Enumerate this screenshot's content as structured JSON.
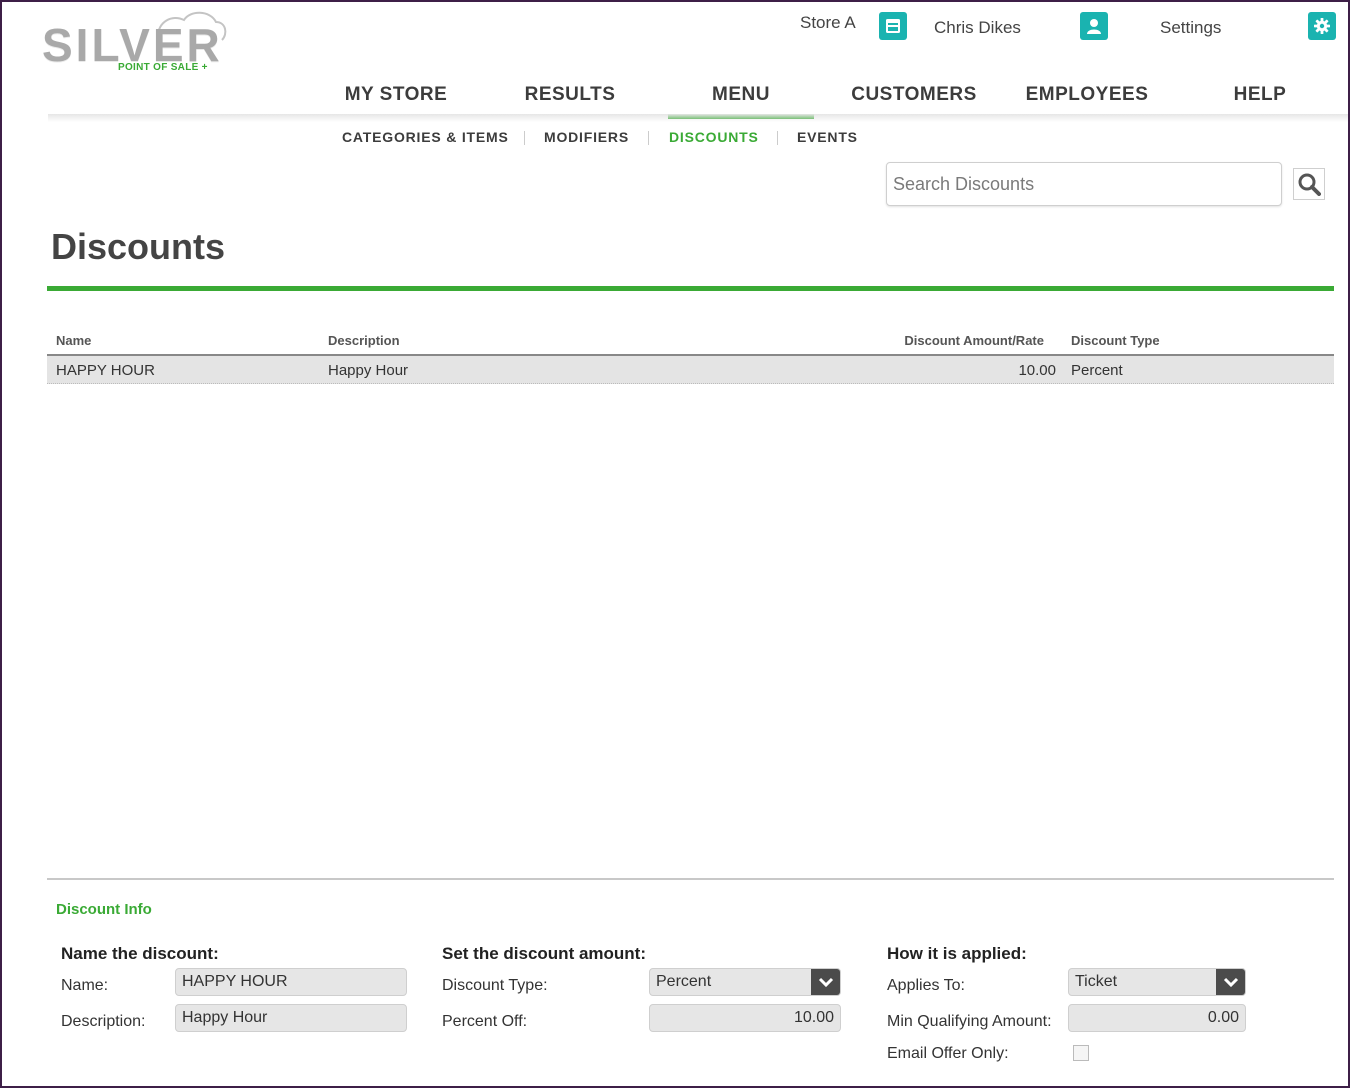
{
  "brand": {
    "logo_text": "SILVER",
    "logo_sub": "POINT OF SALE +",
    "accent_color": "#3aaa35",
    "icon_color": "#1ab3b0"
  },
  "utility": {
    "store": "Store A",
    "store_icon": "store-icon",
    "user": "Chris Dikes",
    "user_icon": "user-icon",
    "settings": "Settings",
    "settings_icon": "gear-icon"
  },
  "main_nav": {
    "items": [
      "MY STORE",
      "RESULTS",
      "MENU",
      "CUSTOMERS",
      "EMPLOYEES",
      "HELP"
    ],
    "active": "MENU"
  },
  "sub_nav": {
    "items": [
      "CATEGORIES & ITEMS",
      "MODIFIERS",
      "DISCOUNTS",
      "EVENTS"
    ],
    "active": "DISCOUNTS"
  },
  "search": {
    "placeholder": "Search Discounts",
    "icon": "search-icon"
  },
  "page": {
    "title": "Discounts"
  },
  "table": {
    "headers": {
      "name": "Name",
      "description": "Description",
      "amount": "Discount Amount/Rate",
      "type": "Discount Type"
    },
    "rows": [
      {
        "name": "HAPPY HOUR",
        "description": "Happy Hour",
        "amount": "10.00",
        "type": "Percent"
      }
    ]
  },
  "discount_info": {
    "title": "Discount Info",
    "name_group": {
      "heading": "Name the discount:",
      "name_label": "Name:",
      "name_value": "HAPPY HOUR",
      "description_label": "Description:",
      "description_value": "Happy Hour"
    },
    "amount_group": {
      "heading": "Set the discount amount:",
      "type_label": "Discount Type:",
      "type_value": "Percent",
      "percent_label": "Percent Off:",
      "percent_value": "10.00"
    },
    "applied_group": {
      "heading": "How it is applied:",
      "applies_label": "Applies To:",
      "applies_value": "Ticket",
      "min_label": "Min Qualifying Amount:",
      "min_value": "0.00",
      "email_label": "Email Offer Only:",
      "email_checked": false
    }
  }
}
